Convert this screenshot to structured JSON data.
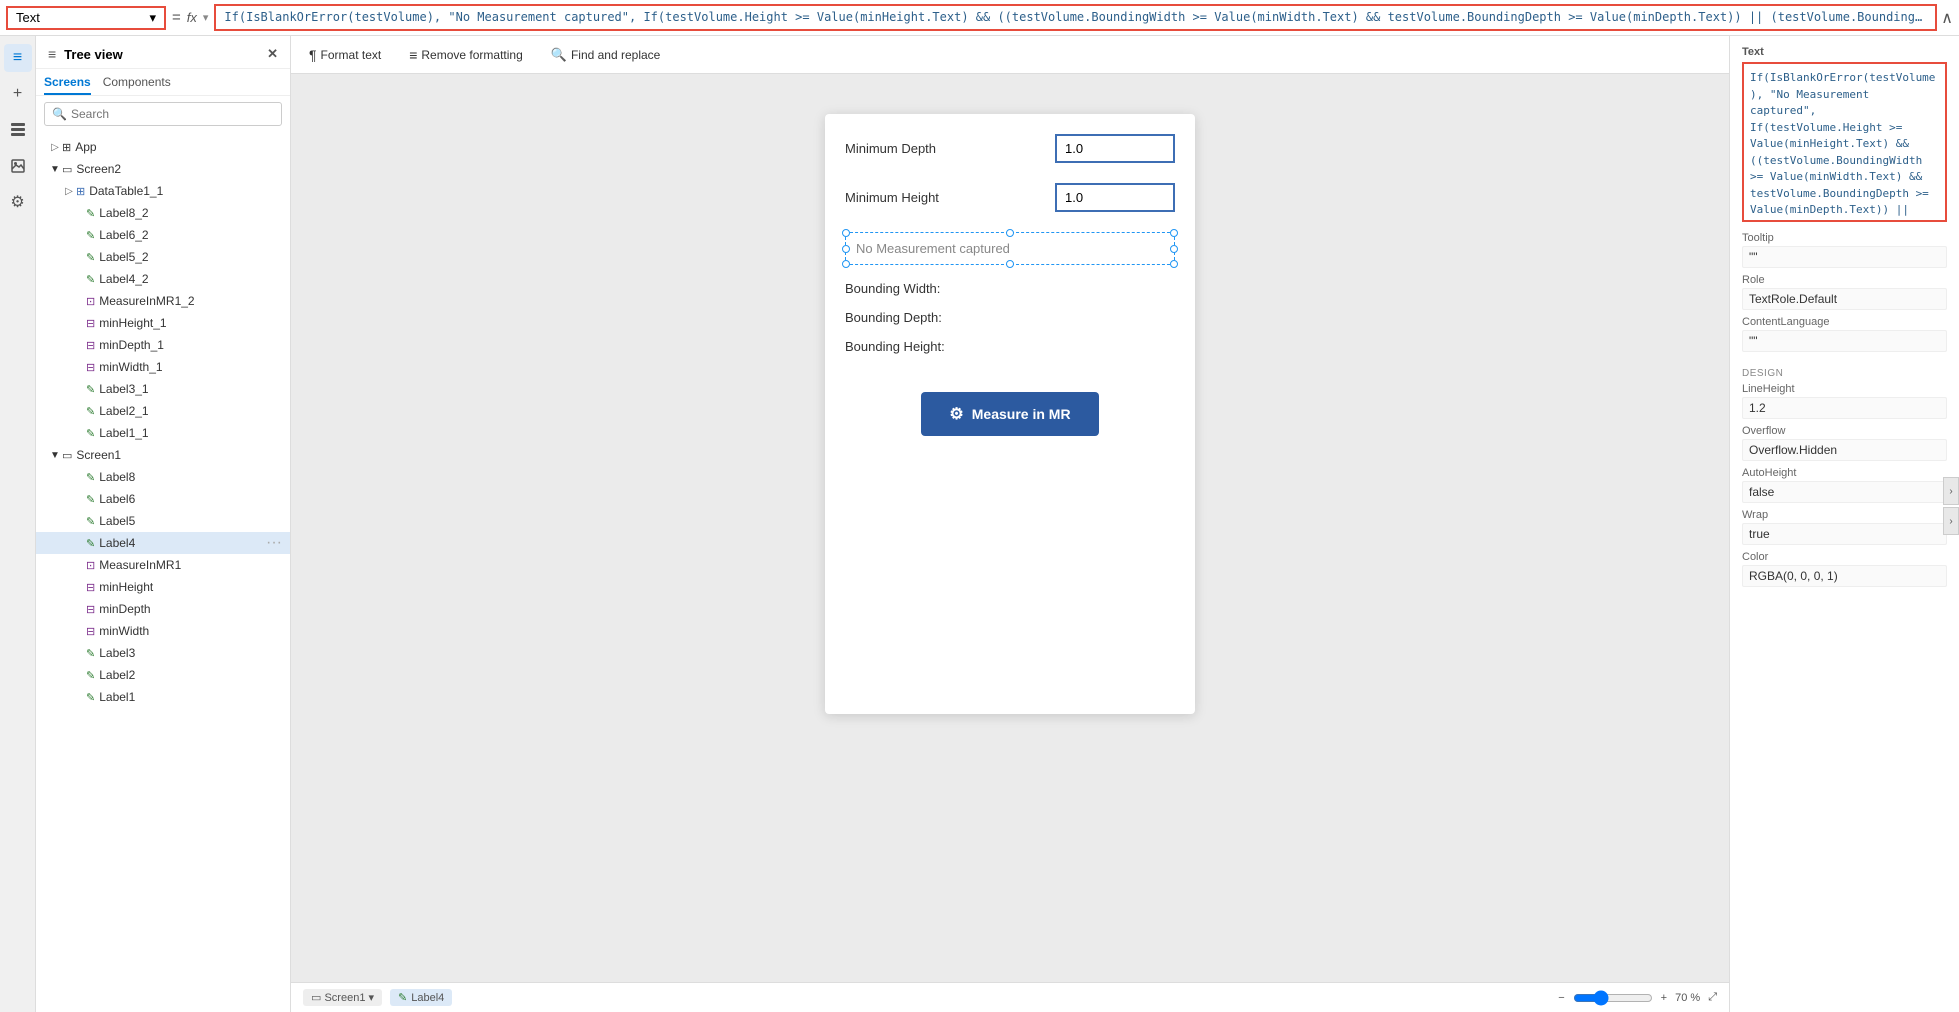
{
  "formula_bar": {
    "selector_label": "Text",
    "selector_arrow": "▾",
    "equals": "=",
    "fx_label": "fx",
    "formula_text": "If(IsBlankOrError(testVolume), \"No Measurement captured\", If(testVolume.Height >= Value(minHeight.Text) && ((testVolume.BoundingWidth >= Value(minWidth.Text) && testVolume.BoundingDepth >= Value(minDepth.Text)) || (testVolume.BoundingWidth >= Value(minDepth.Text) && testVolume.BoundingDepth >= Value(minWidth.Text))), \"Fit Test Succeeded\", \"Fit Test Failed\"))",
    "collapse_up": "∧"
  },
  "tree_panel": {
    "title": "Tree view",
    "close_icon": "✕",
    "hamburger_icon": "☰",
    "tabs": [
      {
        "label": "Screens",
        "active": true
      },
      {
        "label": "Components",
        "active": false
      }
    ],
    "search_placeholder": "Search",
    "app_label": "App",
    "screens": [
      {
        "label": "Screen2",
        "expanded": true,
        "children": [
          {
            "label": "DataTable1_1",
            "icon": "table",
            "expanded": false
          },
          {
            "label": "Label8_2",
            "icon": "label"
          },
          {
            "label": "Label6_2",
            "icon": "label"
          },
          {
            "label": "Label5_2",
            "icon": "label"
          },
          {
            "label": "Label4_2",
            "icon": "label"
          },
          {
            "label": "MeasureInMR1_2",
            "icon": "component"
          },
          {
            "label": "minHeight_1",
            "icon": "input"
          },
          {
            "label": "minDepth_1",
            "icon": "input"
          },
          {
            "label": "minWidth_1",
            "icon": "input"
          },
          {
            "label": "Label3_1",
            "icon": "label"
          },
          {
            "label": "Label2_1",
            "icon": "label"
          },
          {
            "label": "Label1_1",
            "icon": "label"
          }
        ]
      },
      {
        "label": "Screen1",
        "expanded": true,
        "children": [
          {
            "label": "Label8",
            "icon": "label"
          },
          {
            "label": "Label6",
            "icon": "label"
          },
          {
            "label": "Label5",
            "icon": "label"
          },
          {
            "label": "Label4",
            "icon": "label",
            "selected": true,
            "has_dots": true
          },
          {
            "label": "MeasureInMR1",
            "icon": "component"
          },
          {
            "label": "minHeight",
            "icon": "input"
          },
          {
            "label": "minDepth",
            "icon": "input"
          },
          {
            "label": "minWidth",
            "icon": "input"
          },
          {
            "label": "Label3",
            "icon": "label"
          },
          {
            "label": "Label2",
            "icon": "label"
          },
          {
            "label": "Label1",
            "icon": "label"
          }
        ]
      }
    ]
  },
  "toolbar": {
    "format_text_label": "Format text",
    "remove_formatting_label": "Remove formatting",
    "find_replace_label": "Find and replace"
  },
  "canvas": {
    "form": {
      "min_depth_label": "Minimum Depth",
      "min_depth_value": "1.0",
      "min_height_label": "Minimum Height",
      "min_height_value": "1.0",
      "no_measurement_label": "No Measurement captured",
      "bounding_width_label": "Bounding Width:",
      "bounding_depth_label": "Bounding Depth:",
      "bounding_height_label": "Bounding Height:",
      "measure_btn_label": "Measure in MR"
    }
  },
  "status_bar": {
    "screen_label": "Screen1",
    "element_label": "Label4",
    "zoom_minus": "−",
    "zoom_plus": "+",
    "zoom_value": "70 %",
    "expand_icon": "⤢"
  },
  "props_panel": {
    "text_header": "Text",
    "text_formula": "If(IsBlankOrError(testVolume), \"No Measurement captured\", If(testVolume.Height >= Value(minHeight.Text) && ((testVolume.BoundingWidth >= Value(minWidth.Text) && testVolume.BoundingDepth >= Value(minDepth.Text)) || (testVolume.BoundingWidth >= Value(minDepth.Text) && testVolume.BoundingDepth >= Value(minWidth.Text))), \"Fit Test Succeeded\", \"Fit Test Failed\"))",
    "tooltip_label": "Tooltip",
    "tooltip_value": "\"\"",
    "role_label": "Role",
    "role_value": "TextRole.Default",
    "content_language_label": "ContentLanguage",
    "content_language_value": "\"\"",
    "design_label": "DESIGN",
    "line_height_label": "LineHeight",
    "line_height_value": "1.2",
    "overflow_label": "Overflow",
    "overflow_value": "Overflow.Hidden",
    "auto_height_label": "AutoHeight",
    "auto_height_value": "false",
    "wrap_label": "Wrap",
    "wrap_value": "true",
    "color_label": "Color",
    "color_value": "RGBA(0, 0, 0, 1)"
  },
  "icons": {
    "hamburger": "≡",
    "close": "✕",
    "search": "🔍",
    "app_grid": "⊞",
    "screen_rect": "▭",
    "label": "✎",
    "table": "⊞",
    "component": "⊡",
    "input_field": "⊟",
    "expand": "▶",
    "collapse": "▼",
    "format_icon": "¶",
    "remove_format": "⌫",
    "find_replace": "🔍",
    "gear": "⚙",
    "chevron_down": "▾",
    "chevron_up": "∧",
    "chevron_right": "›",
    "left_panel": "◧",
    "layers": "≡",
    "paint": "🖌",
    "data": "⊞",
    "settings": "⚙"
  }
}
